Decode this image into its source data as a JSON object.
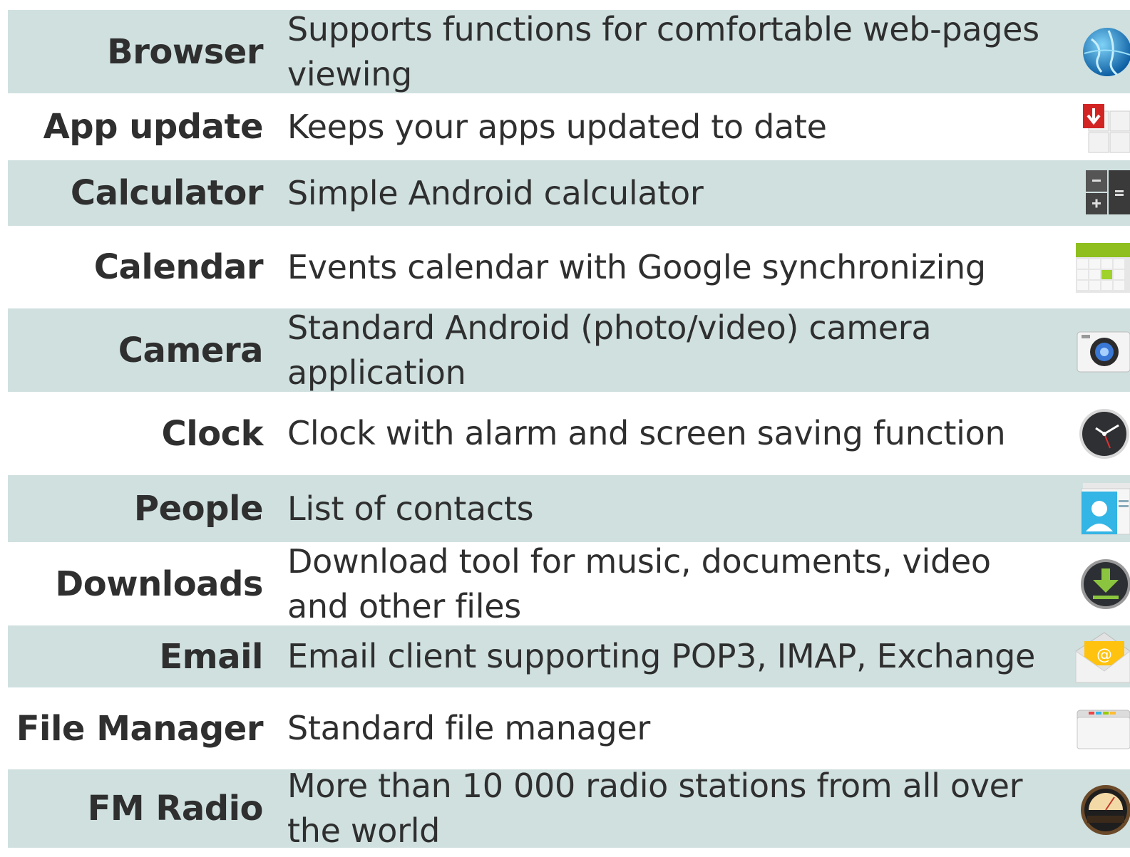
{
  "apps": [
    {
      "name": "Browser",
      "description": "Supports functions for comfortable web-pages viewing",
      "icon": "globe-icon"
    },
    {
      "name": "App update",
      "description": "Keeps your apps updated to date",
      "icon": "app-update-icon"
    },
    {
      "name": "Calculator",
      "description": "Simple Android calculator",
      "icon": "calculator-icon"
    },
    {
      "name": "Calendar",
      "description": "Events calendar with Google synchronizing",
      "icon": "calendar-icon"
    },
    {
      "name": "Camera",
      "description": "Standard Android (photo/video) camera application",
      "icon": "camera-icon"
    },
    {
      "name": "Clock",
      "description": "Clock with alarm and screen saving function",
      "icon": "clock-icon"
    },
    {
      "name": "People",
      "description": "List of contacts",
      "icon": "contacts-icon"
    },
    {
      "name": "Downloads",
      "description": "Download tool for music, documents, video and other files",
      "icon": "download-icon"
    },
    {
      "name": "Email",
      "description": "Email client supporting POP3, IMAP, Exchange",
      "icon": "email-icon"
    },
    {
      "name": "File Manager",
      "description": "Standard file manager",
      "icon": "folder-icon"
    },
    {
      "name": "FM Radio",
      "description": "More than 10 000 radio stations from all over the world",
      "icon": "radio-icon"
    }
  ],
  "colors": {
    "row_shade": "#cfe0df",
    "text": "#2f2f2f"
  }
}
